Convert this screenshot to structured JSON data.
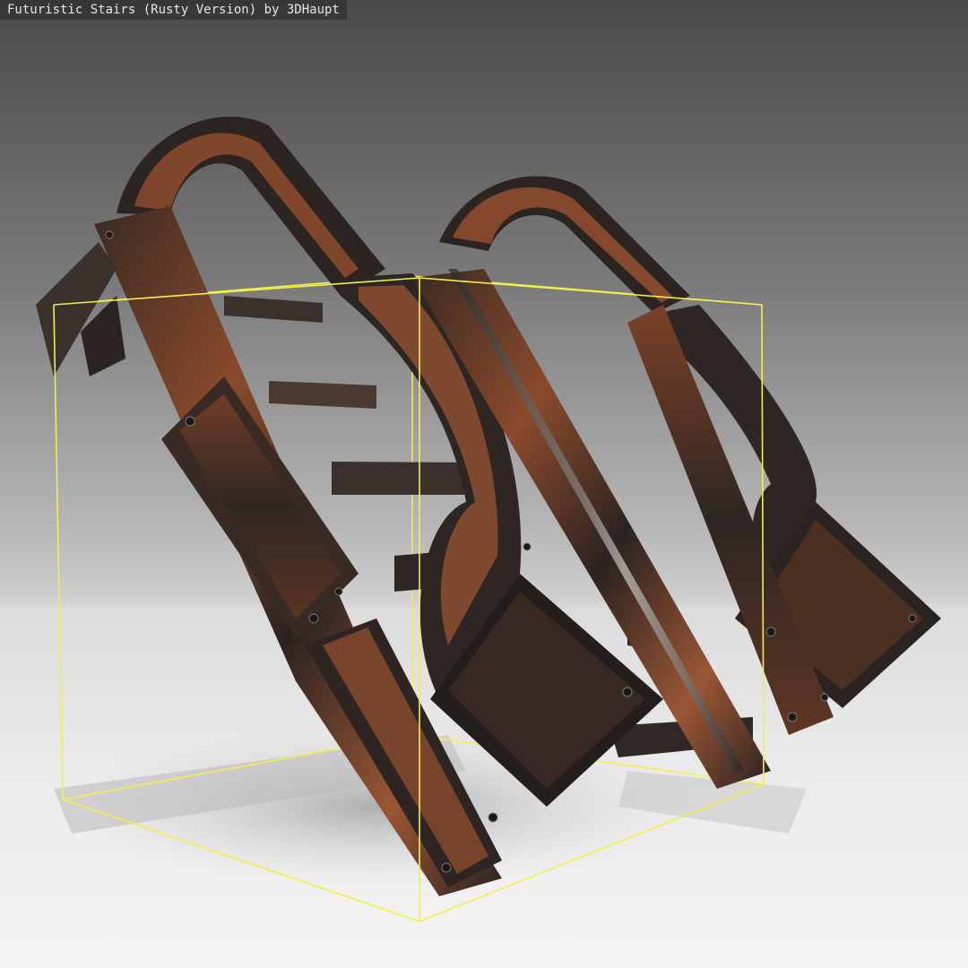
{
  "viewer": {
    "title": "Futuristic Stairs (Rusty Version) by 3DHaupt"
  },
  "colors": {
    "background_top": "#4a4a4a",
    "floor": "#ebebeb",
    "bounding_box": "#f2ef4a",
    "rust": "#8a4a2c",
    "dark_metal": "#2a2523",
    "steel": "#6e6a66"
  }
}
